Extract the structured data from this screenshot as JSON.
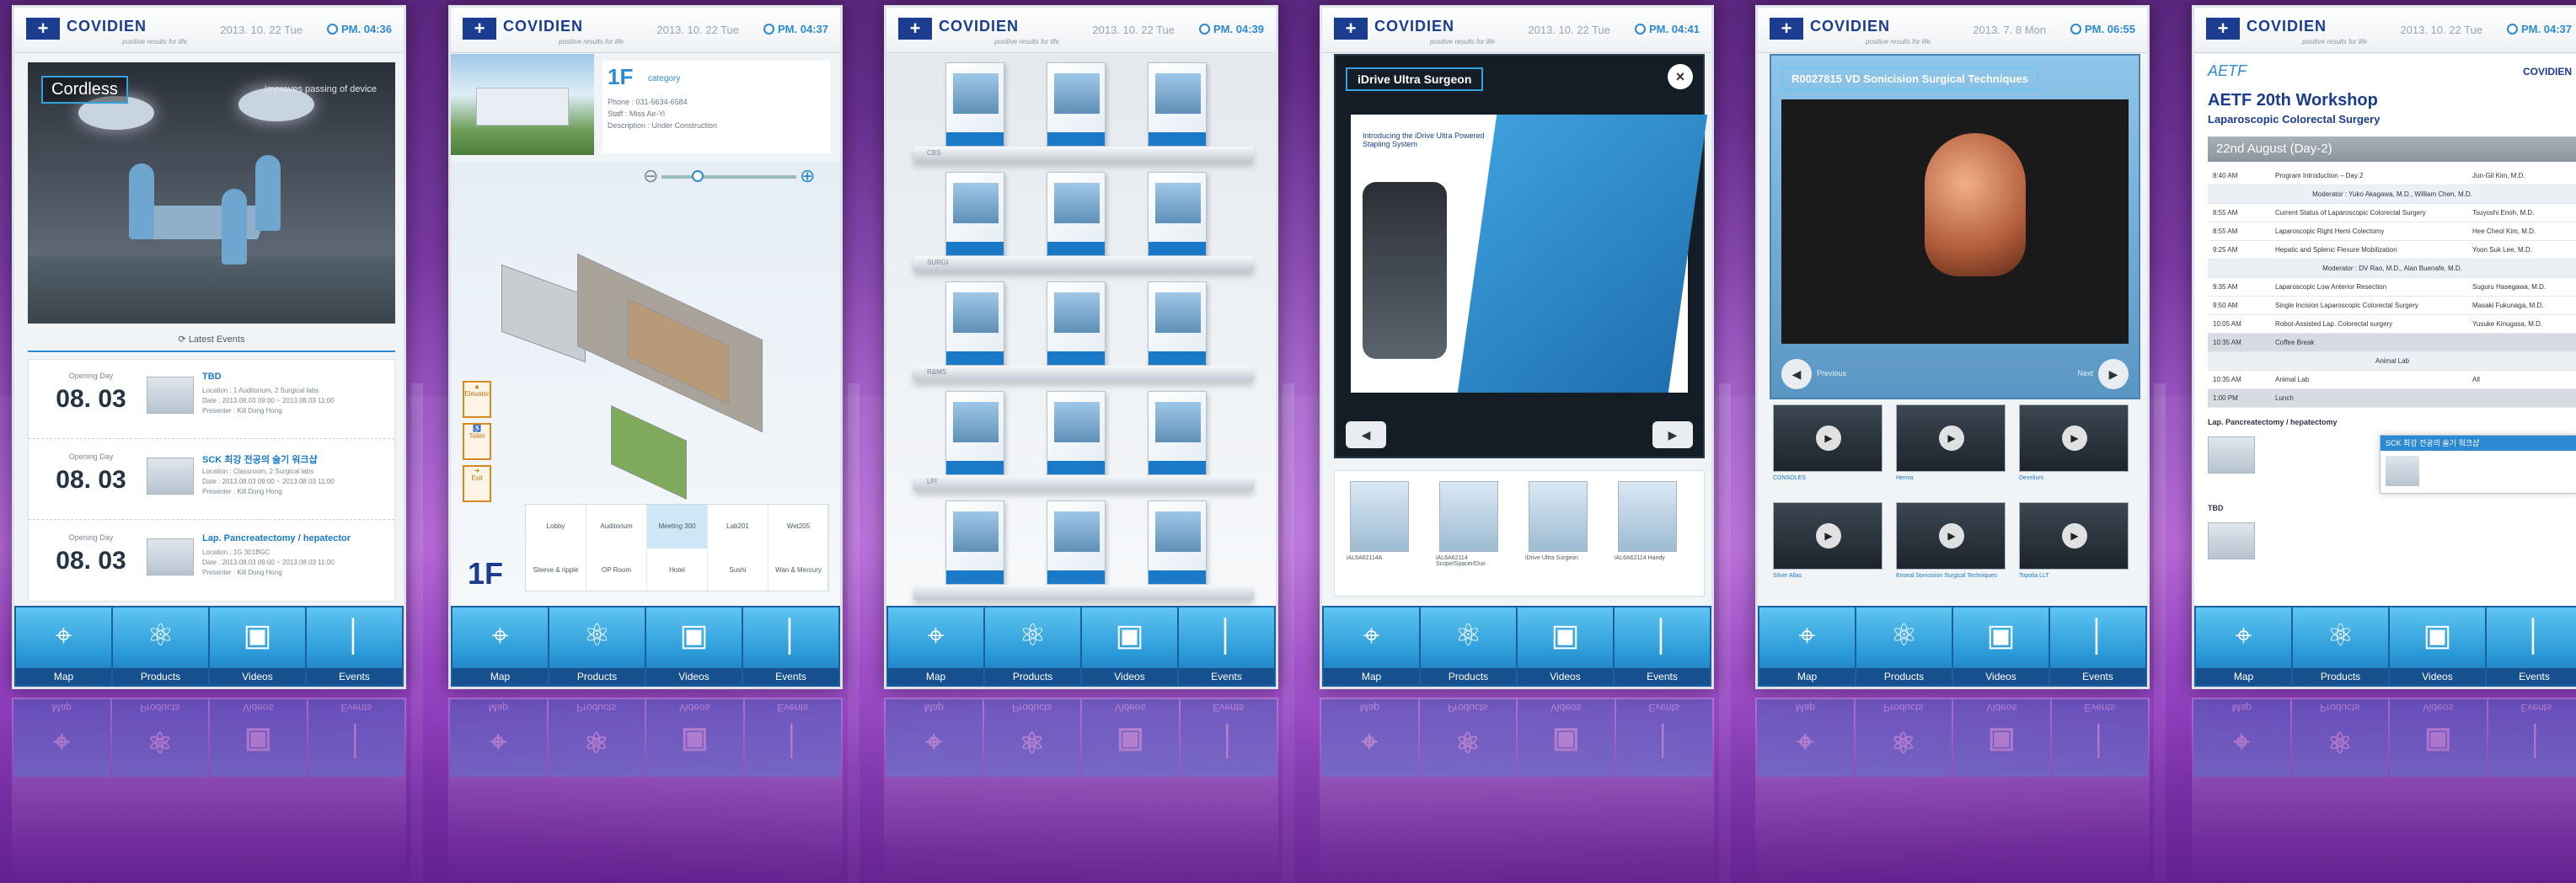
{
  "brand": {
    "name": "COVIDIEN",
    "tagline": "positive results for life"
  },
  "nav": [
    {
      "label": "Map",
      "icon": "map-pin-icon"
    },
    {
      "label": "Products",
      "icon": "atom-icon"
    },
    {
      "label": "Videos",
      "icon": "tv-play-icon"
    },
    {
      "label": "Events",
      "icon": "microphone-icon"
    }
  ],
  "screens": [
    {
      "date": "2013. 10. 22 Tue",
      "time": "PM. 04:36"
    },
    {
      "date": "2013. 10. 22 Tue",
      "time": "PM. 04:37"
    },
    {
      "date": "2013. 10. 22 Tue",
      "time": "PM. 04:39"
    },
    {
      "date": "2013. 10. 22 Tue",
      "time": "PM. 04:41"
    },
    {
      "date": "2013. 7. 8 Mon",
      "time": "PM. 06:55"
    },
    {
      "date": "2013. 10. 22 Tue",
      "time": "PM. 04:37"
    }
  ],
  "panel1": {
    "badge": "Cordless",
    "badge_sub": "Improves passing of device",
    "latest": "Latest Events",
    "events": [
      {
        "label": "Opening Day",
        "date": "08. 03",
        "title": "TBD",
        "lines": [
          "Location : 1 Auditorium, 2 Surgical labs",
          "Date : 2013.08.03 09:00 ~ 2013.08.03 11:00",
          "Presenter : Kill Dong Hong"
        ]
      },
      {
        "label": "Opening Day",
        "date": "08. 03",
        "title": "SCK 최강 전공의 술기 워크샵",
        "lines": [
          "Location : Classroom, 2 Surgical labs",
          "Date : 2013.08.03 09:00 ~ 2013.08.03 11:00",
          "Presenter : Kill Dong Hong"
        ]
      },
      {
        "label": "Opening Day",
        "date": "08. 03",
        "title": "Lap. Pancreatectomy / hepatector",
        "lines": [
          "Location : 1G 301BGC",
          "Date : 2013.08.03 09:00 ~ 2013.08.03 11:00",
          "Presenter : Kill Dong Hong"
        ]
      }
    ]
  },
  "panel2": {
    "floor": "1F",
    "category": "category",
    "lines": [
      "Phone : 031-5634-6584",
      "Staff : Miss Ae-Yi",
      "Description : Under Construction"
    ],
    "side_buttons": [
      "Elevator",
      "Toilet",
      "Exit"
    ],
    "tabs": [
      "Lobby",
      "Auditorium",
      "Meeting 300",
      "Lab201",
      "Wet205",
      "Sleeve & ripple",
      "OP Room",
      "Hotel",
      "Sushi",
      "Wan & Mercury"
    ]
  },
  "panel3": {
    "shelves": [
      "CBS",
      "SURGI",
      "R&MS",
      "LPI",
      ""
    ]
  },
  "panel4": {
    "title": "iDrive Ultra Surgeon",
    "close": "×",
    "brochure_caption": "Introducing the iDrive Ultra Powered Stapling System",
    "thumbs": [
      "iAL6A62114A",
      "iAL6A62114 Scope/Spacer/Duo",
      "iDrive Ultra Surgeon",
      "iAL6A62114 Handy"
    ]
  },
  "panel5": {
    "title": "R0027815 VD Sonicision Surgical Techniques",
    "prev": "Previous",
    "next": "Next",
    "videos": [
      "CONSOLES",
      "Hernia",
      "Dexelium",
      "Silver Allas",
      "Enseal Sonicision Surgical Techniques",
      "Topolia LLT"
    ]
  },
  "panel6": {
    "org": "AETF",
    "cv": "COVIDIEN",
    "title": "AETF 20th Workshop",
    "subtitle": "Laparoscopic Colorectal Surgery",
    "day": "22nd August (Day-2)",
    "rows": [
      {
        "t": "8:40 AM",
        "p": "Program Introduction – Day 2",
        "s": "Jun-Gil Kim, M.D.",
        "type": ""
      },
      {
        "t": "",
        "p": "Moderator : Yuko Akagawa, M.D., William Chen, M.D.",
        "s": "",
        "type": "mod"
      },
      {
        "t": "8:55 AM",
        "p": "Current Status of Laparoscopic Colorectal Surgery",
        "s": "Tsuyoshi Enoh, M.D.",
        "type": ""
      },
      {
        "t": "8:55 AM",
        "p": "Laparoscopic Right Hemi Colectomy",
        "s": "Hee Cheol Kim, M.D.",
        "type": ""
      },
      {
        "t": "9:25 AM",
        "p": "Hepatic and Splenic Flexure Mobilization",
        "s": "Yoon Suk Lee, M.D.",
        "type": ""
      },
      {
        "t": "",
        "p": "Moderator : DV Rao, M.D., Alan Buenafe, M.D.",
        "s": "",
        "type": "mod"
      },
      {
        "t": "9:35 AM",
        "p": "Laparoscopic Low Anterior Resection",
        "s": "Suguru Hasegawa, M.D.",
        "type": ""
      },
      {
        "t": "9:50 AM",
        "p": "Single Incision Laparoscopic Colorectal Surgery",
        "s": "Masaki Fukunaga, M.D.",
        "type": ""
      },
      {
        "t": "10:05 AM",
        "p": "Robot-Assisted Lap. Colorectal surgery",
        "s": "Yusuke Kinugasa, M.D.",
        "type": ""
      },
      {
        "t": "10:35 AM",
        "p": "Coffee Break",
        "s": "",
        "type": "gray"
      },
      {
        "t": "",
        "p": "Animal Lab",
        "s": "",
        "type": "mod"
      },
      {
        "t": "10:35 AM",
        "p": "Animal Lab",
        "s": "All",
        "type": ""
      },
      {
        "t": "1:00 PM",
        "p": "Lunch",
        "s": "",
        "type": "gray"
      }
    ],
    "section1": "Lap. Pancreatectomy / hepatectomy",
    "section2": "TBD",
    "popup": "SCK 최강 전공의 술기 워크샵"
  }
}
